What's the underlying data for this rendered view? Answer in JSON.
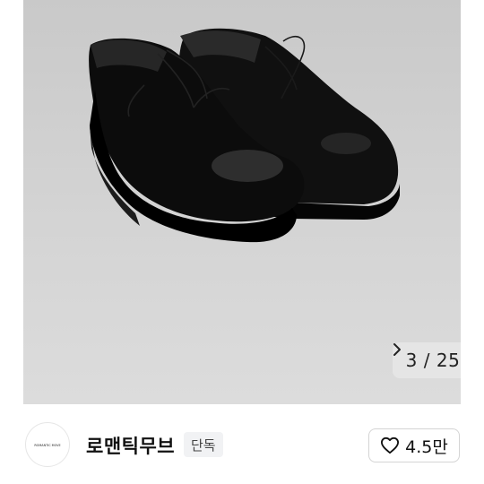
{
  "gallery": {
    "current": "3",
    "separator": "/",
    "total": "25",
    "next_icon": "chevron-right-icon"
  },
  "brand": {
    "logo_text": "ROMANTIC MOVE",
    "name": "로맨틱무브",
    "badge": "단독"
  },
  "like": {
    "icon": "heart-outline-icon",
    "count": "4.5만"
  }
}
